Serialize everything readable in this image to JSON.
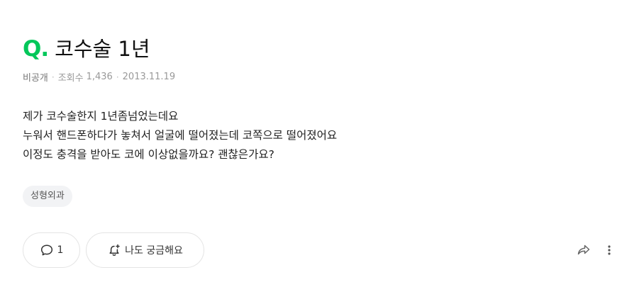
{
  "question": {
    "prefix": "Q",
    "dot": ".",
    "title": "코수술 1년"
  },
  "meta": {
    "author": "비공개",
    "views_label": "조회수",
    "views": "1,436",
    "date": "2013.11.19"
  },
  "body": {
    "lines": [
      "제가 코수술한지 1년좀넘었는데요",
      "누워서 핸드폰하다가 놓쳐서 얼굴에 떨어졌는데 코쪽으로 떨어졌어요",
      "이정도 충격을 받아도 코에 이상없을까요? 괜찮은가요?"
    ]
  },
  "tags": [
    "성형외과"
  ],
  "actions": {
    "comment_count": "1",
    "curious_label": "나도 궁금해요"
  },
  "colors": {
    "accent": "#03c75a"
  },
  "icons": {
    "comment": "speech-bubble-icon",
    "curious": "bell-plus-icon",
    "share": "share-arrow-icon",
    "more": "vertical-dots-icon"
  }
}
